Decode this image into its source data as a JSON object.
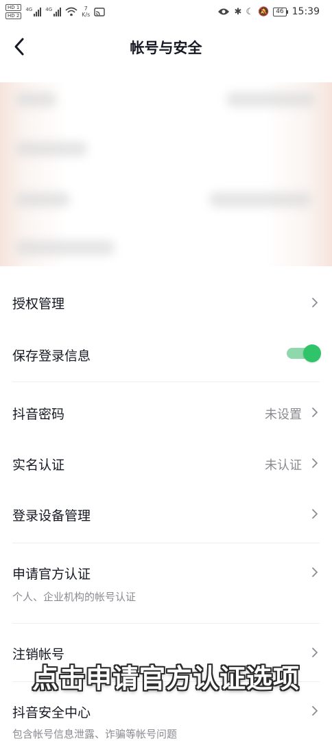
{
  "status_bar": {
    "hd1": "HD 1",
    "hd2": "HD 2",
    "net1": "4G",
    "net2": "4G",
    "speed_value": "7",
    "speed_unit": "K/s",
    "battery": "46",
    "time": "15:39"
  },
  "header": {
    "title": "帐号与安全"
  },
  "settings": {
    "items": [
      {
        "label": "授权管理"
      },
      {
        "label": "保存登录信息",
        "toggle_on": true
      },
      {
        "label": "抖音密码",
        "value": "未设置"
      },
      {
        "label": "实名认证",
        "value": "未认证"
      },
      {
        "label": "登录设备管理"
      },
      {
        "label": "申请官方认证",
        "sub": "个人、企业机构的帐号认证"
      },
      {
        "label": "注销帐号"
      },
      {
        "label": "抖音安全中心",
        "sub": "包含帐号信息泄露、诈骗等帐号问题"
      }
    ]
  },
  "caption": {
    "text": "点击申请官方认证选项"
  },
  "colors": {
    "toggle_on": "#2fc36a",
    "text_primary": "#161823",
    "text_secondary": "#8a8b91"
  }
}
